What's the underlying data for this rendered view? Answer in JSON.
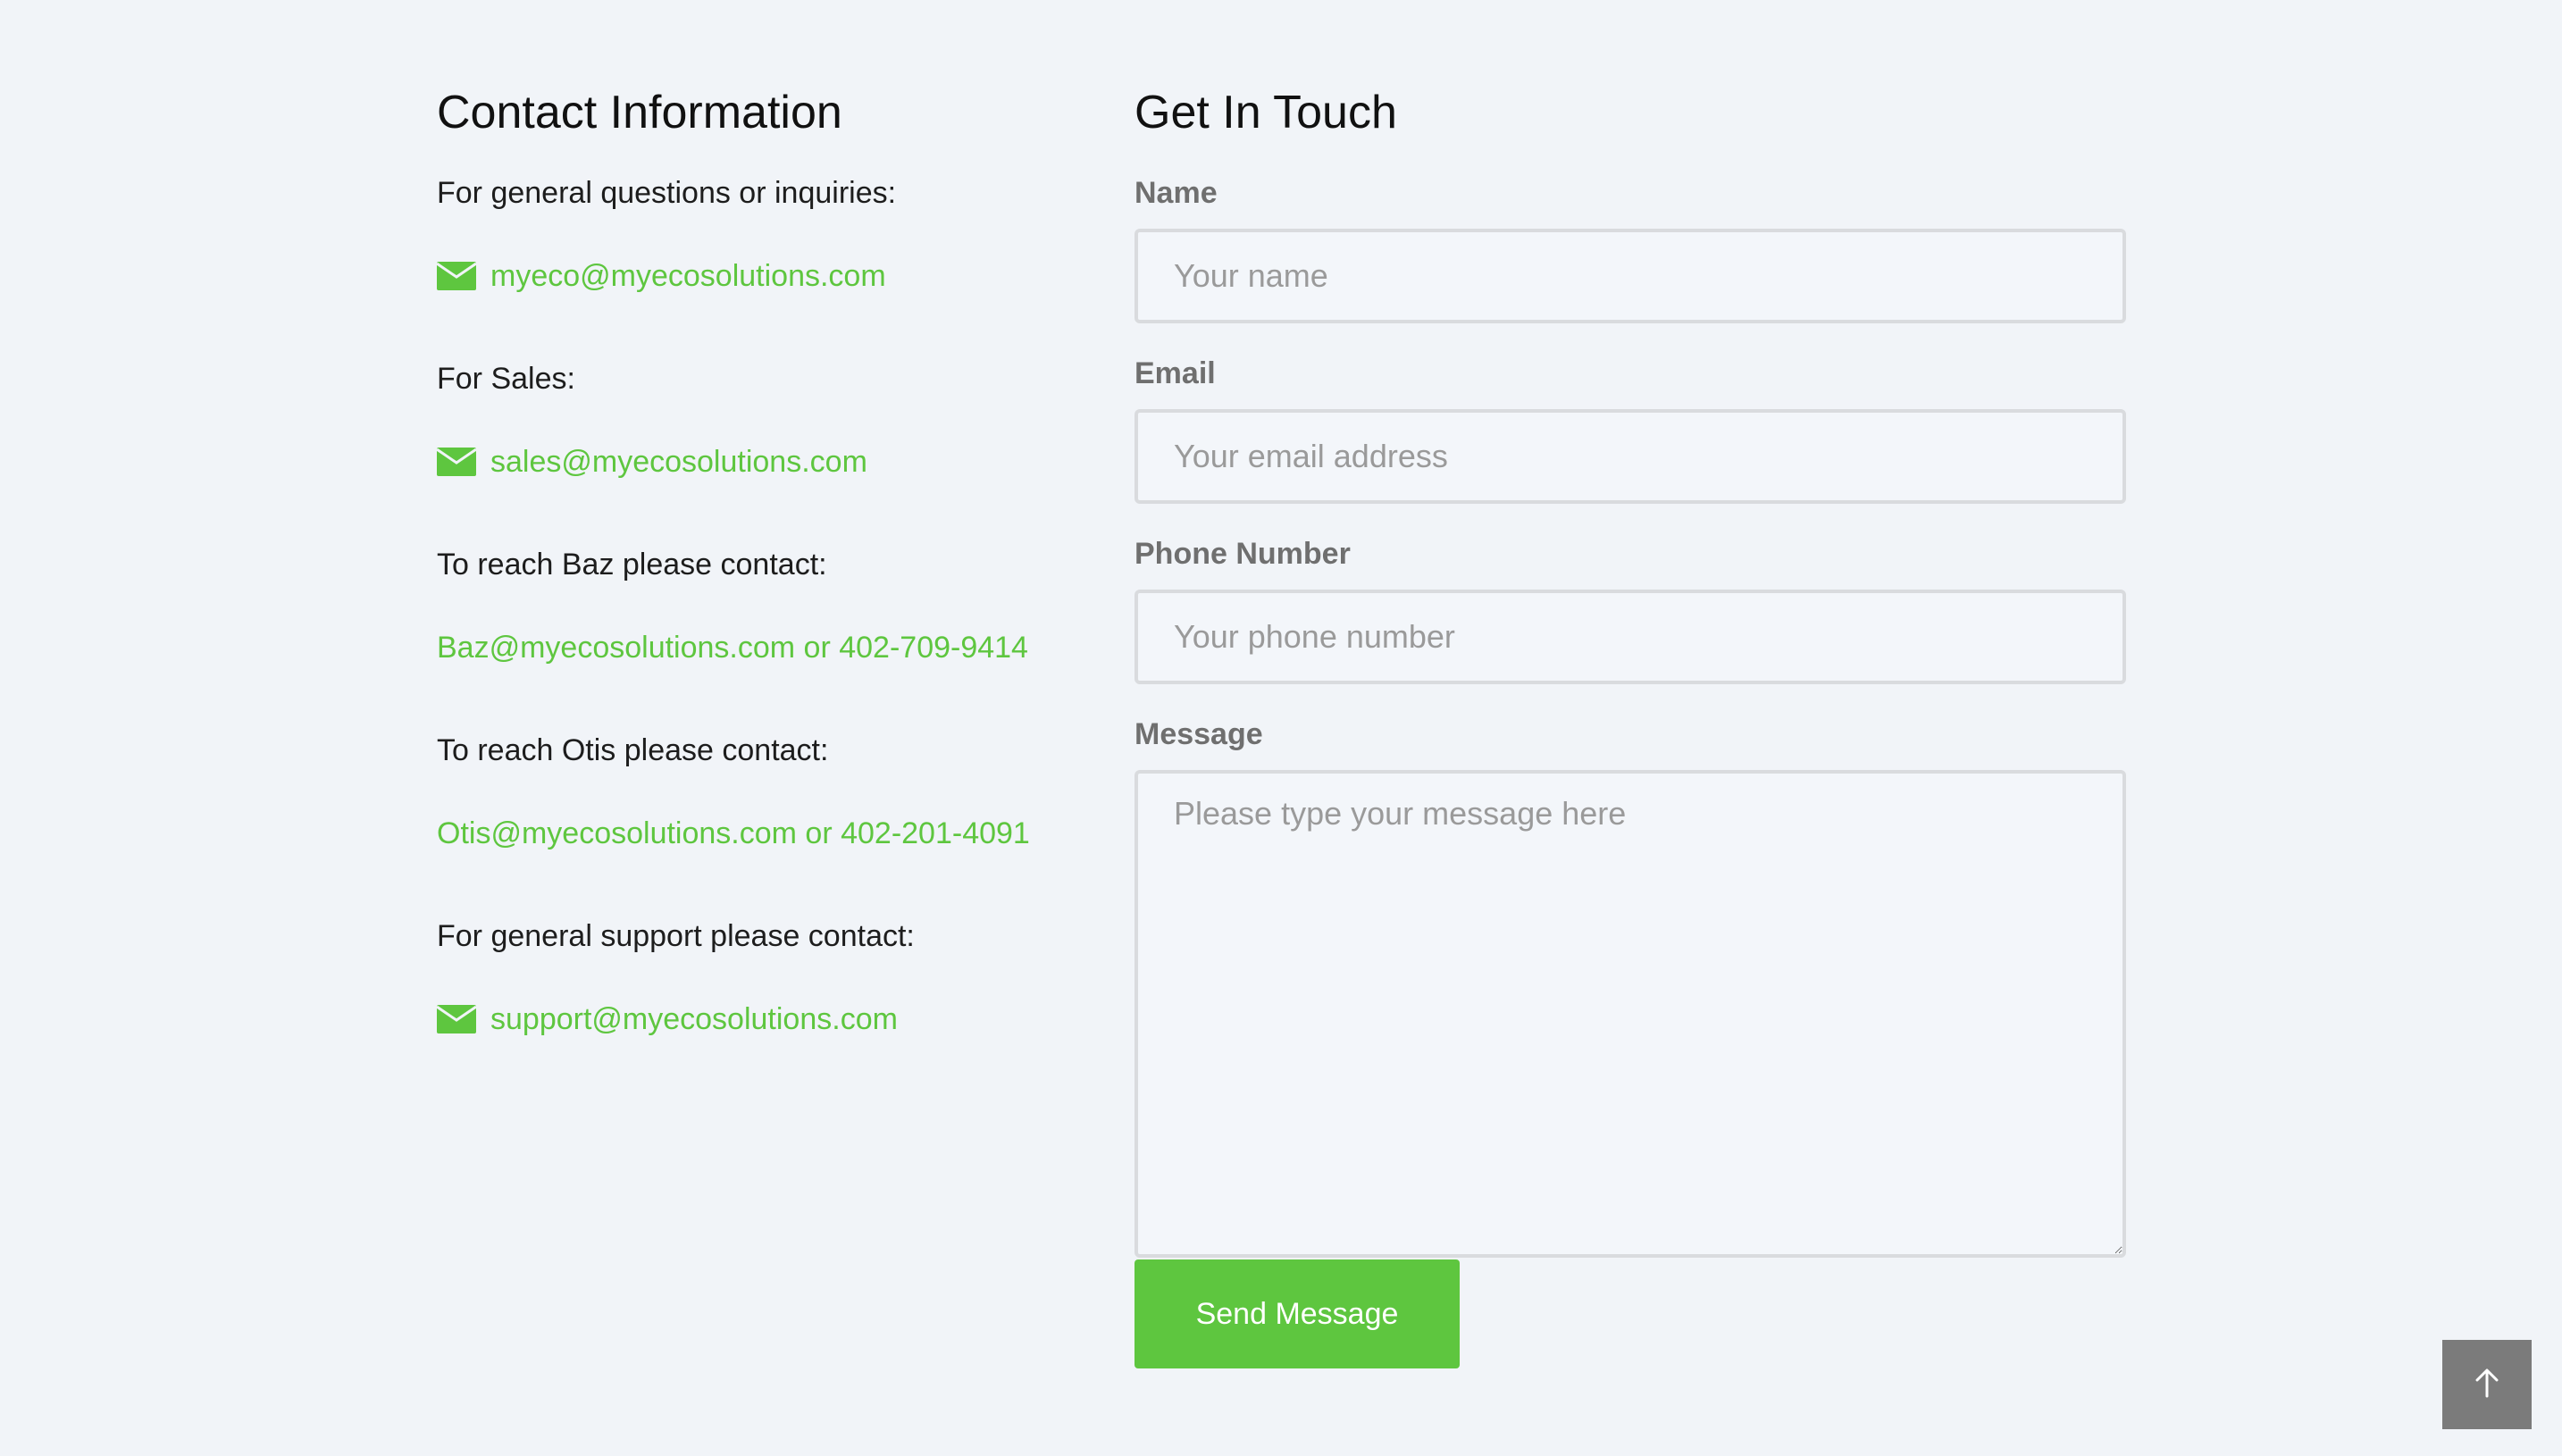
{
  "contact_info": {
    "heading": "Contact Information",
    "general": {
      "label": "For general questions or inquiries:",
      "email": "myeco@myecosolutions.com"
    },
    "sales": {
      "label": "For Sales:",
      "email": "sales@myecosolutions.com"
    },
    "baz": {
      "label": "To reach Baz please contact:",
      "link": "Baz@myecosolutions.com or 402-709-9414"
    },
    "otis": {
      "label": "To reach Otis please contact:",
      "link": "Otis@myecosolutions.com or 402-201-4091"
    },
    "support": {
      "label": "For general support please contact:",
      "email": "support@myecosolutions.com"
    }
  },
  "form": {
    "heading": "Get In Touch",
    "name": {
      "label": "Name",
      "placeholder": "Your name",
      "value": ""
    },
    "email": {
      "label": "Email",
      "placeholder": "Your email address",
      "value": ""
    },
    "phone": {
      "label": "Phone Number",
      "placeholder": "Your phone number",
      "value": ""
    },
    "message": {
      "label": "Message",
      "placeholder": "Please type your message here",
      "value": ""
    },
    "submit_label": "Send Message"
  },
  "icons": {
    "mail": "envelope-icon",
    "back_to_top": "arrow-up-icon"
  },
  "colors": {
    "accent": "#5ec63f",
    "background": "#f1f4f8",
    "to_top_button": "#7b7b7b"
  }
}
